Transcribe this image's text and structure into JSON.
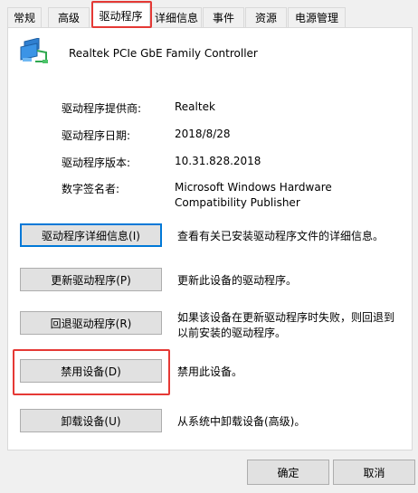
{
  "tabs": [
    {
      "label": "常规"
    },
    {
      "label": "高级"
    },
    {
      "label": "驱动程序"
    },
    {
      "label": "详细信息"
    },
    {
      "label": "事件"
    },
    {
      "label": "资源"
    },
    {
      "label": "电源管理"
    }
  ],
  "device": {
    "name": "Realtek PCIe GbE Family Controller",
    "icon": "network-adapter-icon"
  },
  "properties": {
    "provider_label": "驱动程序提供商:",
    "provider_value": "Realtek",
    "date_label": "驱动程序日期:",
    "date_value": "2018/8/28",
    "version_label": "驱动程序版本:",
    "version_value": "10.31.828.2018",
    "signer_label": "数字签名者:",
    "signer_value_line1": "Microsoft Windows Hardware",
    "signer_value_line2": "Compatibility Publisher"
  },
  "actions": [
    {
      "label": "驱动程序详细信息(I)",
      "description": "查看有关已安装驱动程序文件的详细信息。"
    },
    {
      "label": "更新驱动程序(P)",
      "description": "更新此设备的驱动程序。"
    },
    {
      "label": "回退驱动程序(R)",
      "description_line1": "如果该设备在更新驱动程序时失败，则回退到",
      "description_line2": "以前安装的驱动程序。"
    },
    {
      "label": "禁用设备(D)",
      "description": "禁用此设备。"
    },
    {
      "label": "卸载设备(U)",
      "description": "从系统中卸载设备(高级)。"
    }
  ],
  "footer": {
    "ok_label": "确定",
    "cancel_label": "取消"
  },
  "colors": {
    "highlight": "#e53935",
    "focus": "#0078d7"
  }
}
